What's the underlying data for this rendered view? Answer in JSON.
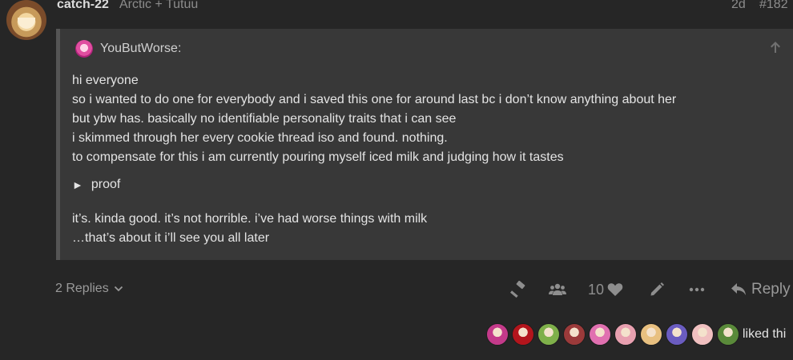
{
  "post": {
    "username": "catch-22",
    "user_title": "Arctic + Tutuu",
    "age": "2d",
    "number": "#182",
    "avatar_icon": "avatar"
  },
  "quote": {
    "author": "YouButWorse:",
    "lines": [
      "hi everyone",
      "so i wanted to do one for everybody and i saved this one for around last bc i don’t know anything about her",
      "but ybw has. basically no identifiable personality traits that i can see",
      "i skimmed through her every cookie thread iso and found. nothing.",
      "to compensate for this i am currently pouring myself iced milk and judging how it tastes"
    ],
    "details_arrow": "►",
    "details_label": "proof",
    "tail_lines": [
      "it’s. kinda good. it’s not horrible. i’ve had worse things with milk",
      "…that’s about it i’ll see you all later"
    ]
  },
  "footer": {
    "replies_label": "2 Replies",
    "like_count": "10",
    "reply_label": "Reply",
    "icons": [
      "gavel-icon",
      "users-icon",
      "heart-icon",
      "pencil-icon",
      "ellipsis-icon",
      "reply-icon"
    ]
  },
  "likes": {
    "text": "liked thi",
    "avatar_colors": [
      "#c43a8a",
      "#b3151c",
      "#7fb04a",
      "#9b3a3a",
      "#e070b0",
      "#e8a0b0",
      "#e8c080",
      "#6a5cc0",
      "#f0c0c0",
      "#5a8a3a"
    ]
  }
}
